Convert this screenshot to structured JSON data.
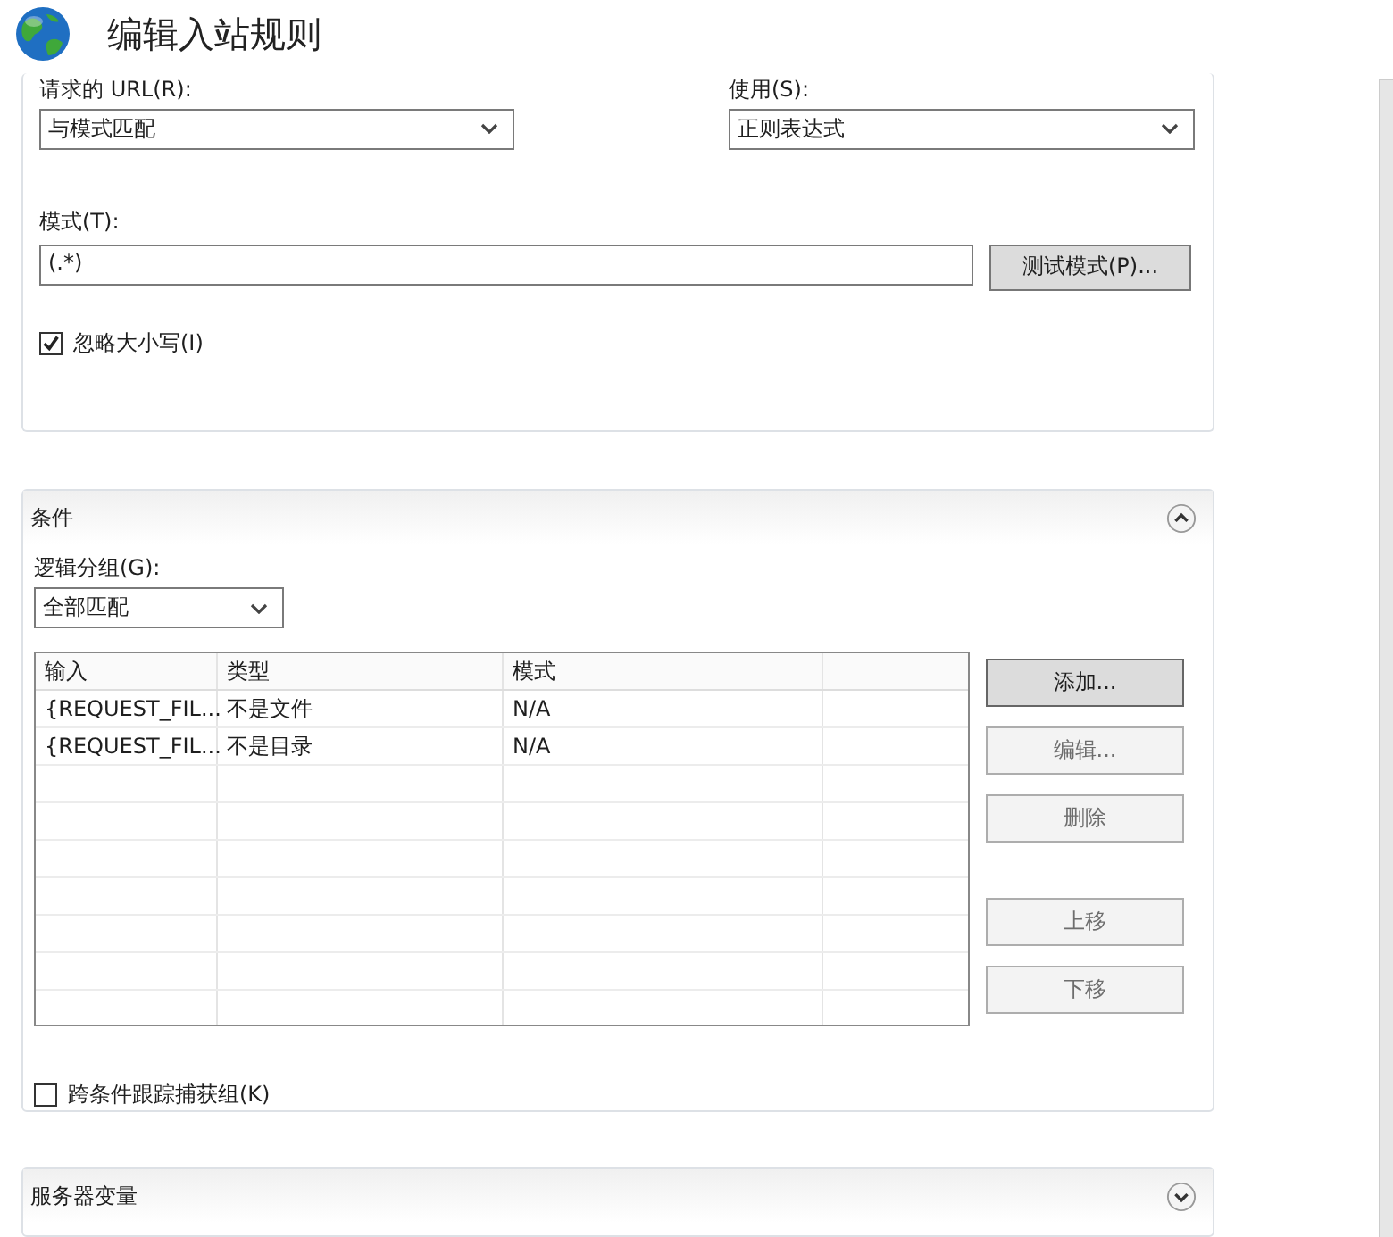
{
  "title": "编辑入站规则",
  "match": {
    "url_label": "请求的 URL(R):",
    "url_value": "与模式匹配",
    "using_label": "使用(S):",
    "using_value": "正则表达式",
    "pattern_label": "模式(T):",
    "pattern_value": "(.*)",
    "test_button": "测试模式(P)...",
    "ignore_case": {
      "label": "忽略大小写(I)",
      "checked": true
    }
  },
  "conditions": {
    "title": "条件",
    "expanded": true,
    "grouping_label": "逻辑分组(G):",
    "grouping_value": "全部匹配",
    "table": {
      "columns": [
        "输入",
        "类型",
        "模式"
      ],
      "rows": [
        [
          "{REQUEST_FIL...",
          "不是文件",
          "N/A"
        ],
        [
          "{REQUEST_FIL...",
          "不是目录",
          "N/A"
        ]
      ]
    },
    "edit_buttons": [
      {
        "label": "添加...",
        "disabled": false
      },
      {
        "label": "编辑...",
        "disabled": true
      },
      {
        "label": "删除",
        "disabled": true
      }
    ],
    "move_buttons": [
      {
        "label": "上移",
        "disabled": true
      },
      {
        "label": "下移",
        "disabled": true
      }
    ],
    "track_groups": {
      "label": "跨条件跟踪捕获组(K)",
      "checked": false
    }
  },
  "server_variables": {
    "title": "服务器变量",
    "expanded": false
  }
}
